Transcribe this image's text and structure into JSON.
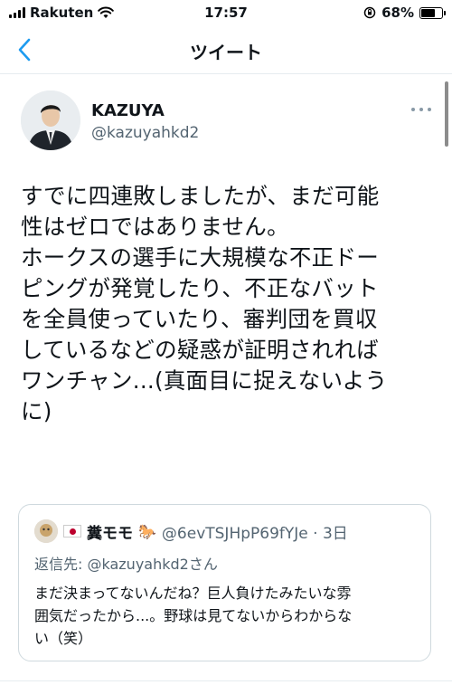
{
  "status_bar": {
    "carrier": "Rakuten",
    "time": "17:57",
    "battery_percent": "68%",
    "battery_level": 0.68
  },
  "nav": {
    "title": "ツイート",
    "back_icon": "chevron-left-icon"
  },
  "tweet": {
    "display_name": "KAZUYA",
    "handle": "@kazuyahkd2",
    "text": "すでに四連敗しましたが、まだ可能\n性はゼロではありません。\nホークスの選手に大規模な不正ドー\nピングが発覚したり、不正なバット\nを全員使っていたり、審判団を買収\nしているなどの疑惑が証明されれば\nワンチャン...(真面目に捉えないよう\nに)"
  },
  "quoted_tweet": {
    "display_name": "糞モモ",
    "handle_time": "@6evTSJHpP69fYJe · 3日",
    "reply_label": "返信先: ",
    "reply_user": "@kazuyahkd2さん",
    "text": "まだ決まってないんだね？巨人負けたみたいな雰\n囲気だったから...。野球は見てないからわからな\nい（笑）",
    "horse_emoji": "🐎"
  },
  "colors": {
    "accent": "#1d9bf0",
    "secondary_text": "#536471",
    "border": "#cfd9de"
  }
}
